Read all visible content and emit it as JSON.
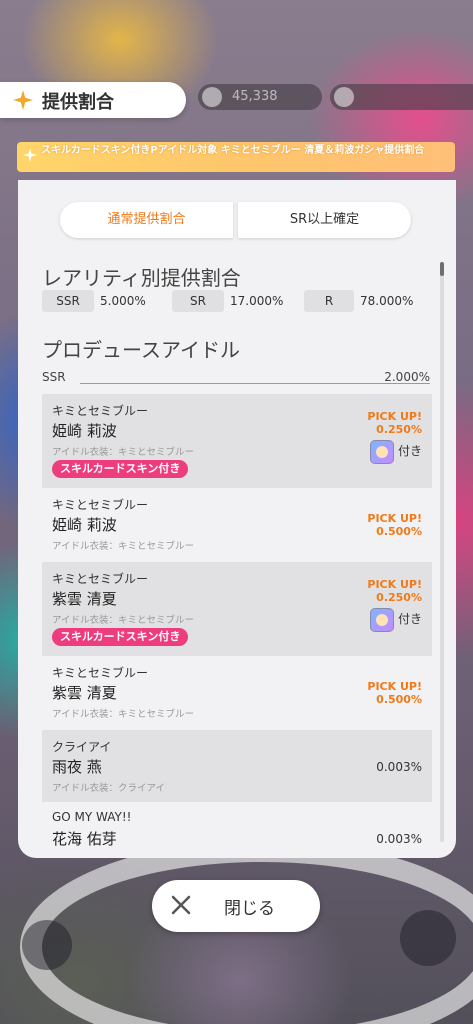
{
  "header": {
    "title": "提供割合"
  },
  "topbar": {
    "currency": "45,338"
  },
  "banner": {
    "text": "スキルカードスキン付きPアイドル対象 キミとセミブルー 清夏＆莉波ガシャ提供割合"
  },
  "tabs": [
    {
      "label": "通常提供割合",
      "active": true
    },
    {
      "label": "SR以上確定",
      "active": false
    }
  ],
  "rarity_section": {
    "title": "レアリティ別提供割合",
    "items": [
      {
        "label": "SSR",
        "value": "5.000%"
      },
      {
        "label": "SR",
        "value": "17.000%"
      },
      {
        "label": "R",
        "value": "78.000%"
      }
    ]
  },
  "idol_section": {
    "title": "プロデュースアイドル",
    "ssr_label": "SSR",
    "ssr_total": "2.000%"
  },
  "idols": [
    {
      "unit": "キミとセミブルー",
      "name": "姫崎 莉波",
      "costume": "アイドル衣装：キミとセミブルー",
      "tag": "スキルカードスキン付き",
      "pickup": "PICK UP!",
      "rate": "0.250%",
      "skin_label": "付き"
    },
    {
      "unit": "キミとセミブルー",
      "name": "姫崎 莉波",
      "costume": "アイドル衣装：キミとセミブルー",
      "pickup": "PICK UP!",
      "rate": "0.500%"
    },
    {
      "unit": "キミとセミブルー",
      "name": "紫雲 清夏",
      "costume": "アイドル衣装：キミとセミブルー",
      "tag": "スキルカードスキン付き",
      "pickup": "PICK UP!",
      "rate": "0.250%",
      "skin_label": "付き"
    },
    {
      "unit": "キミとセミブルー",
      "name": "紫雲 清夏",
      "costume": "アイドル衣装：キミとセミブルー",
      "pickup": "PICK UP!",
      "rate": "0.500%"
    },
    {
      "unit": "クライアイ",
      "name": "雨夜 燕",
      "costume": "アイドル衣装：クライアイ",
      "rate": "0.003%"
    },
    {
      "unit": "GO MY WAY!!",
      "name": "花海 佑芽",
      "rate": "0.003%"
    }
  ],
  "close_button": {
    "label": "閉じる"
  },
  "colors": {
    "accent": "#ef7a1a",
    "tag": "#ee3d7e",
    "banner": "#ffc66b"
  }
}
